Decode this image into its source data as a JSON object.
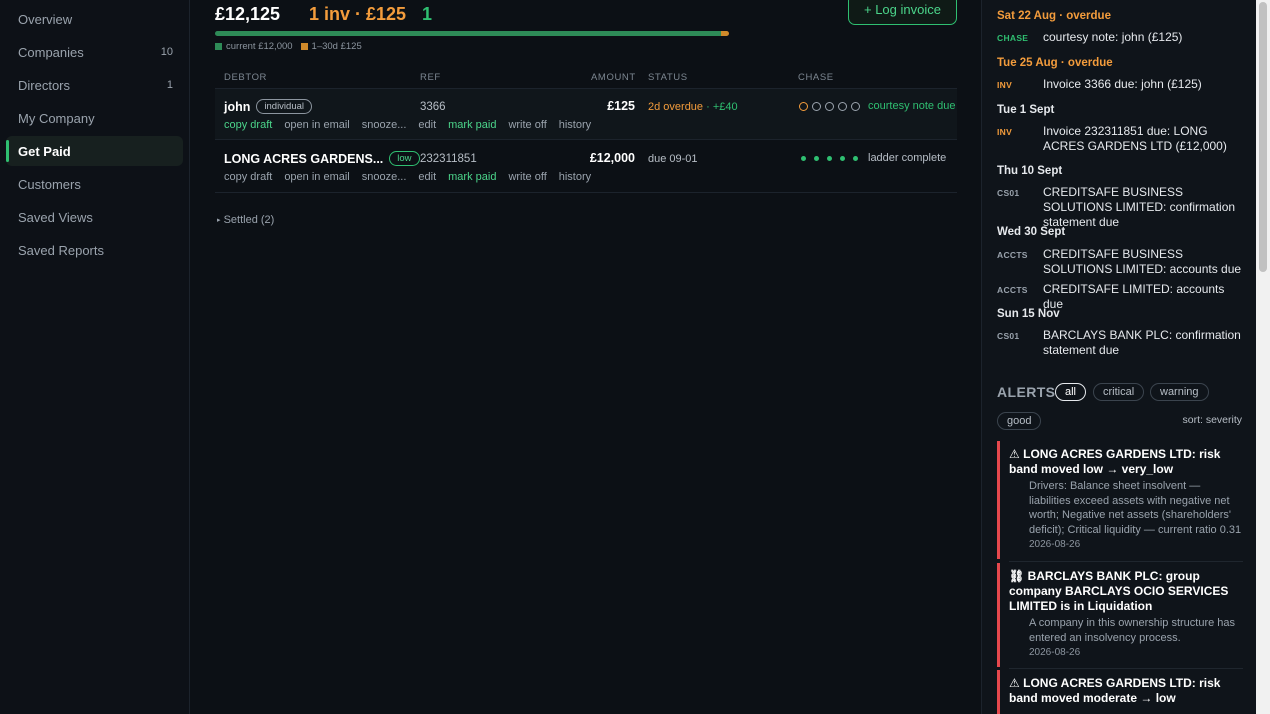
{
  "sidebar": {
    "items": [
      {
        "label": "Overview",
        "count": ""
      },
      {
        "label": "Companies",
        "count": "10"
      },
      {
        "label": "Directors",
        "count": "1"
      },
      {
        "label": "My Company",
        "count": ""
      },
      {
        "label": "Get Paid",
        "count": "",
        "active": true
      },
      {
        "label": "Customers",
        "count": ""
      },
      {
        "label": "Saved Views",
        "count": ""
      },
      {
        "label": "Saved Reports",
        "count": ""
      }
    ]
  },
  "summary": {
    "total": "£12,125",
    "overdue": "1 inv · £125",
    "third": "1",
    "log_button": "+ Log invoice",
    "progress": {
      "current_fraction": 0.985,
      "overdue_fraction": 0.015
    },
    "legend": {
      "current": "current £12,000",
      "overdue": "1–30d £125"
    },
    "colors": {
      "current": "#2e8b57",
      "overdue": "#d08a2a"
    }
  },
  "table": {
    "headers": {
      "debtor": "DEBTOR",
      "ref": "REF",
      "amount": "AMOUNT",
      "status": "STATUS",
      "chase": "CHASE"
    },
    "rows": [
      {
        "debtor": "john",
        "pill": "individual",
        "ref": "3366",
        "amount": "£125",
        "status": "2d overdue",
        "status_extra": "· +£40",
        "chase_label": "courtesy note due",
        "actions": [
          "copy draft",
          "open in email",
          "snooze...",
          "edit",
          "mark paid",
          "write off",
          "history"
        ]
      },
      {
        "debtor": "LONG ACRES GARDENS...",
        "pill": "low",
        "ref": "232311851",
        "amount": "£12,000",
        "status": "due 09-01",
        "status_extra": "",
        "chase_label": "ladder complete",
        "actions": [
          "copy draft",
          "open in email",
          "snooze...",
          "edit",
          "mark paid",
          "write off",
          "history"
        ]
      }
    ]
  },
  "settled": "Settled (2)",
  "calendar": [
    {
      "day": "Sat 22 Aug · overdue",
      "tag": "CHASE",
      "text": "courtesy note: john (£125)"
    },
    {
      "day": "Tue 25 Aug · overdue",
      "tag": "INV",
      "text": "Invoice 3366 due: john (£125)"
    },
    {
      "day": "Tue 1 Sept",
      "tag": "INV",
      "text": "Invoice 232311851 due: LONG ACRES GARDENS LTD (£12,000)"
    },
    {
      "day": "Thu 10 Sept",
      "tag": "CS01",
      "text": "CREDITSAFE BUSINESS SOLUTIONS LIMITED: confirmation statement due"
    },
    {
      "day": "Wed 30 Sept",
      "tag": "ACCTS",
      "text": "CREDITSAFE BUSINESS SOLUTIONS LIMITED: accounts due"
    },
    {
      "day": "",
      "tag": "ACCTS",
      "text": "CREDITSAFE LIMITED: accounts due"
    },
    {
      "day": "Sun 15 Nov",
      "tag": "CS01",
      "text": "BARCLAYS BANK PLC: confirmation statement due"
    }
  ],
  "alerts": {
    "heading": "ALERTS",
    "filters": [
      "all",
      "critical",
      "warning",
      "good"
    ],
    "sort": "sort: severity",
    "items": [
      {
        "icon": "⚠",
        "title": "LONG ACRES GARDENS LTD: risk band moved low → very_low",
        "desc": "Drivers: Balance sheet insolvent — liabilities exceed assets with negative net worth; Negative net assets (shareholders' deficit); Critical liquidity — current ratio 0.31",
        "date": "2026-08-26"
      },
      {
        "icon": "⛓",
        "title": "BARCLAYS BANK PLC: group company BARCLAYS OCIO SERVICES LIMITED is in Liquidation",
        "desc": "A company in this ownership structure has entered an insolvency process.",
        "date": "2026-08-26"
      },
      {
        "icon": "⚠",
        "title": "LONG ACRES GARDENS LTD: risk band moved moderate → low",
        "desc": "",
        "date": ""
      }
    ],
    "severity_color": "#e5484d"
  }
}
